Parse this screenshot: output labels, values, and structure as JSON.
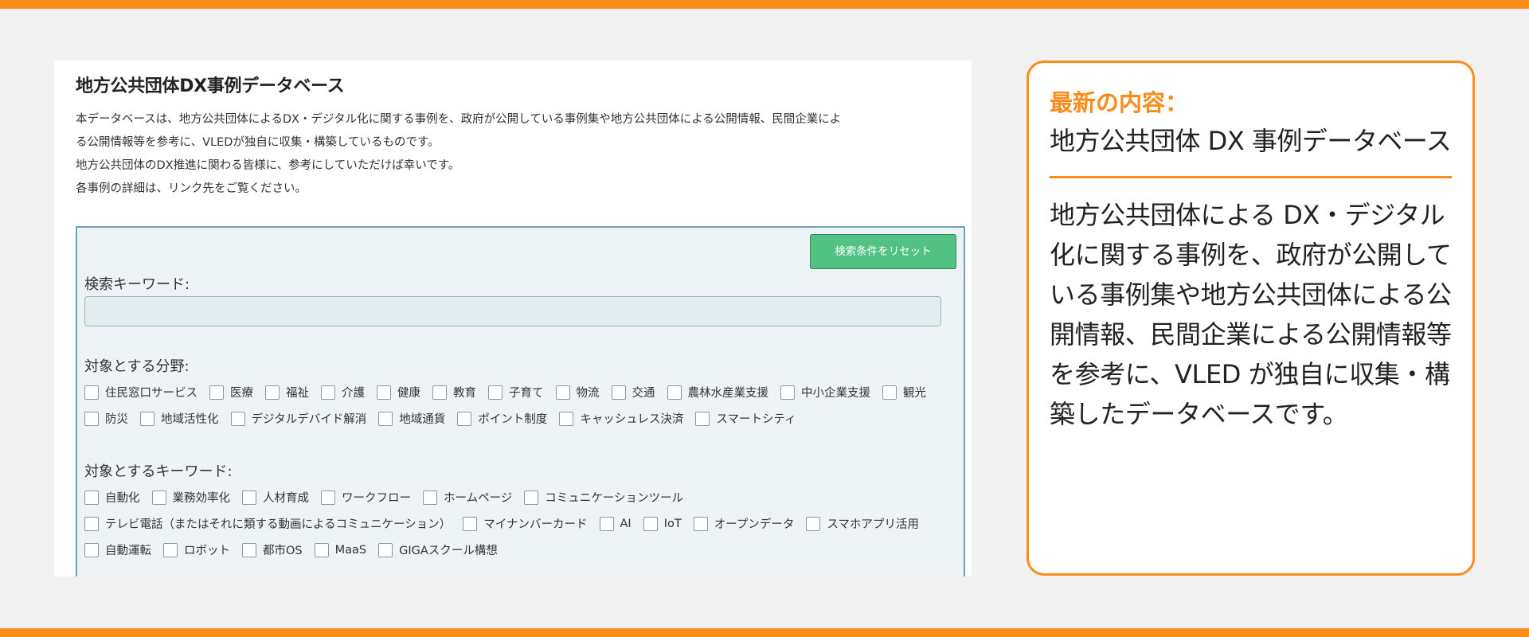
{
  "database": {
    "title": "地方公共団体DX事例データベース",
    "description": [
      "本データベースは、地方公共団体によるDX・デジタル化に関する事例を、政府が公開している事例集や地方公共団体による公開情報、民間企業によ",
      "る公開情報等を参考に、VLEDが独自に収集・構築しているものです。",
      "地方公共団体のDX推進に関わる皆様に、参考にしていただけば幸いです。",
      "各事例の詳細は、リンク先をご覧ください。"
    ],
    "reset_button_label": "検索条件をリセット",
    "keyword_label": "検索キーワード:",
    "keyword_value": "",
    "fields_label": "対象とする分野:",
    "fields_rows": [
      [
        "住民窓口サービス",
        "医療",
        "福祉",
        "介護",
        "健康",
        "教育",
        "子育て",
        "物流",
        "交通",
        "農林水産業支援",
        "中小企業支援",
        "観光"
      ],
      [
        "防災",
        "地域活性化",
        "デジタルデバイド解消",
        "地域通貨",
        "ポイント制度",
        "キャッシュレス決済",
        "スマートシティ"
      ]
    ],
    "keywords_label": "対象とするキーワード:",
    "keywords_rows": [
      [
        "自動化",
        "業務効率化",
        "人材育成",
        "ワークフロー",
        "ホームページ",
        "コミュニケーションツール"
      ],
      [
        "テレビ電話（またはそれに類する動画によるコミュニケーション）",
        "マイナンバーカード",
        "AI",
        "IoT",
        "オープンデータ",
        "スマホアプリ活用"
      ],
      [
        "自動運転",
        "ロボット",
        "都市OS",
        "MaaS",
        "GIGAスクール構想"
      ]
    ]
  },
  "panel": {
    "heading": "最新の内容：",
    "title": "地方公共団体 DX 事例データベース",
    "body": "地方公共団体による DX・デジタル化に関する事例を、政府が公開している事例集や地方公共団体による公開情報、民間企業による公開情報等を参考に、VLED が独自に収集・構築したデータベースです。"
  },
  "colors": {
    "accent_orange": "#fb8c19",
    "reset_button_green": "#51c184",
    "search_box_border": "#6fa3b5",
    "background": "#f2f2f2"
  }
}
